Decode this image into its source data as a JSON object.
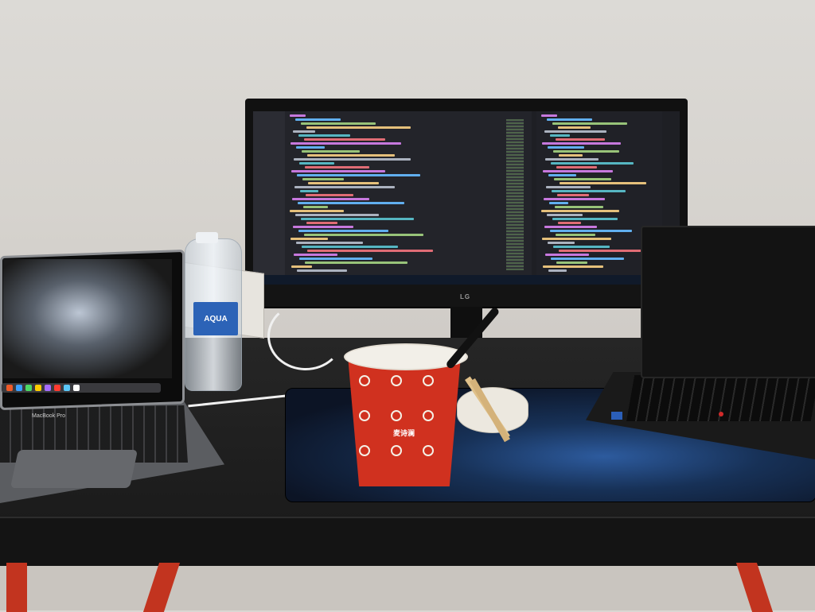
{
  "scene": {
    "objects": [
      "monitor",
      "macbook",
      "thinkpad",
      "water-bottle",
      "noodle-cup",
      "desk-mat"
    ]
  },
  "monitor": {
    "brand_label": "LG"
  },
  "macbook": {
    "label": "MacBook Pro"
  },
  "bottle": {
    "label": "AQUA"
  },
  "cup": {
    "brand": "麦诗澜"
  },
  "colors": {
    "desk": "#1b1b1b",
    "wall": "#d9d7d3",
    "cup_red": "#d0311f",
    "trestle_legs": "#c2341f",
    "mat_blue": "#2d5b9e"
  }
}
